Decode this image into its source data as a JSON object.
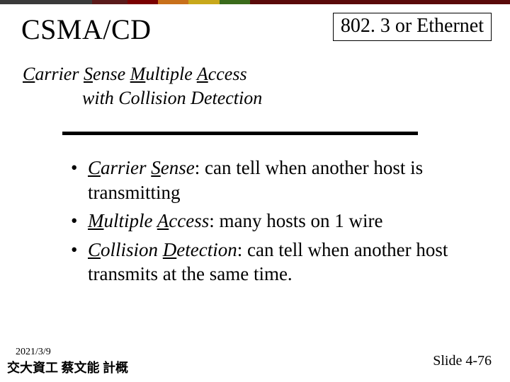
{
  "header": {
    "title": "CSMA/CD",
    "badge": "802. 3 or Ethernet"
  },
  "subtitle": {
    "c": "C",
    "arrier": "arrier ",
    "s": "S",
    "ense": "ense ",
    "m": "M",
    "ultiple": "ultiple ",
    "a": "A",
    "ccess": "ccess",
    "line2_prefix": "with   ",
    "cd_c": "C",
    "ollision": "ollision ",
    "cd_d": "D",
    "etection": "etection"
  },
  "bullets": {
    "items": [
      {
        "term_u": "C",
        "term_rest": "arrier ",
        "term_u2": "S",
        "term_rest2": "ense",
        "text": ": can tell when another host is transmitting"
      },
      {
        "term_u": "M",
        "term_rest": "ultiple ",
        "term_u2": "A",
        "term_rest2": "ccess",
        "text": ": many hosts on 1 wire"
      },
      {
        "term_u": "C",
        "term_rest": "ollision ",
        "term_u2": "D",
        "term_rest2": "etection",
        "text": ": can tell when another host transmits at the same time."
      }
    ]
  },
  "footer": {
    "date": "2021/3/9",
    "author": "交大資工 蔡文能 計概",
    "pager": "Slide 4-76"
  }
}
